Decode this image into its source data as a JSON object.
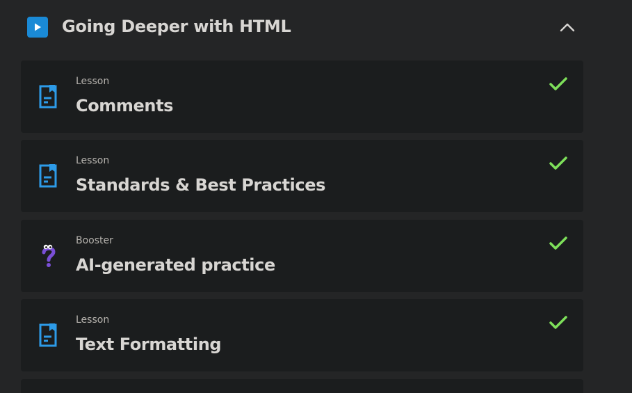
{
  "section": {
    "title": "Going Deeper with HTML",
    "icon": "play-icon",
    "accent": "#1a8ad6",
    "toggle_icon": "chevron-up-icon"
  },
  "items": [
    {
      "type": "Lesson",
      "title": "Comments",
      "icon": "lesson-document-icon",
      "completed": true
    },
    {
      "type": "Lesson",
      "title": "Standards & Best Practices",
      "icon": "lesson-document-icon",
      "completed": true
    },
    {
      "type": "Booster",
      "title": "AI-generated practice",
      "icon": "question-mark-booster-icon",
      "completed": true
    },
    {
      "type": "Lesson",
      "title": "Text Formatting",
      "icon": "lesson-document-icon",
      "completed": true
    }
  ],
  "colors": {
    "background": "#242526",
    "card": "#1b1d1e",
    "check": "#7ee05a",
    "lesson_icon": "#2d9be8",
    "booster_icon": "#7a4fd6"
  }
}
